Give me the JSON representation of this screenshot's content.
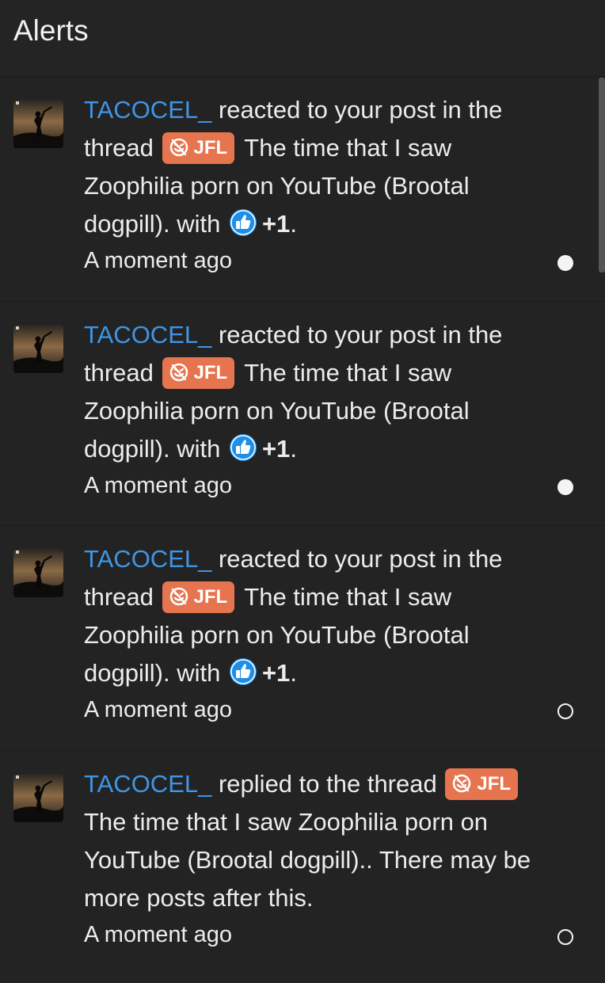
{
  "header": {
    "title": "Alerts"
  },
  "alerts": [
    {
      "user": "TACOCEL_",
      "action": "reacted to your post in the thread",
      "prefix": "JFL",
      "thread_title": "The time that I saw Zoophilia porn on YouTube (Brootal dogpill).",
      "with_text": "with",
      "reaction_icon": "thumbs-up-icon",
      "reaction_label": "+1",
      "end": ".",
      "time": "A moment ago",
      "status": "unread"
    },
    {
      "user": "TACOCEL_",
      "action": "reacted to your post in the thread",
      "prefix": "JFL",
      "thread_title": "The time that I saw Zoophilia porn on YouTube (Brootal dogpill).",
      "with_text": "with",
      "reaction_icon": "thumbs-up-icon",
      "reaction_label": "+1",
      "end": ".",
      "time": "A moment ago",
      "status": "unread"
    },
    {
      "user": "TACOCEL_",
      "action": "reacted to your post in the thread",
      "prefix": "JFL",
      "thread_title": "The time that I saw Zoophilia porn on YouTube (Brootal dogpill).",
      "with_text": "with",
      "reaction_icon": "thumbs-up-icon",
      "reaction_label": "+1",
      "end": ".",
      "time": "A moment ago",
      "status": "read"
    },
    {
      "user": "TACOCEL_",
      "action": "replied to the thread",
      "prefix": "JFL",
      "thread_title": "The time that I saw Zoophilia porn on YouTube (Brootal dogpill).",
      "suffix": ". There may be more posts after this.",
      "time": "A moment ago",
      "status": "read"
    }
  ],
  "colors": {
    "background": "#242424",
    "username": "#3f95e6",
    "prefix_badge": "#e5744f",
    "reaction_icon": "#1d8fe8",
    "text": "#ececec"
  }
}
